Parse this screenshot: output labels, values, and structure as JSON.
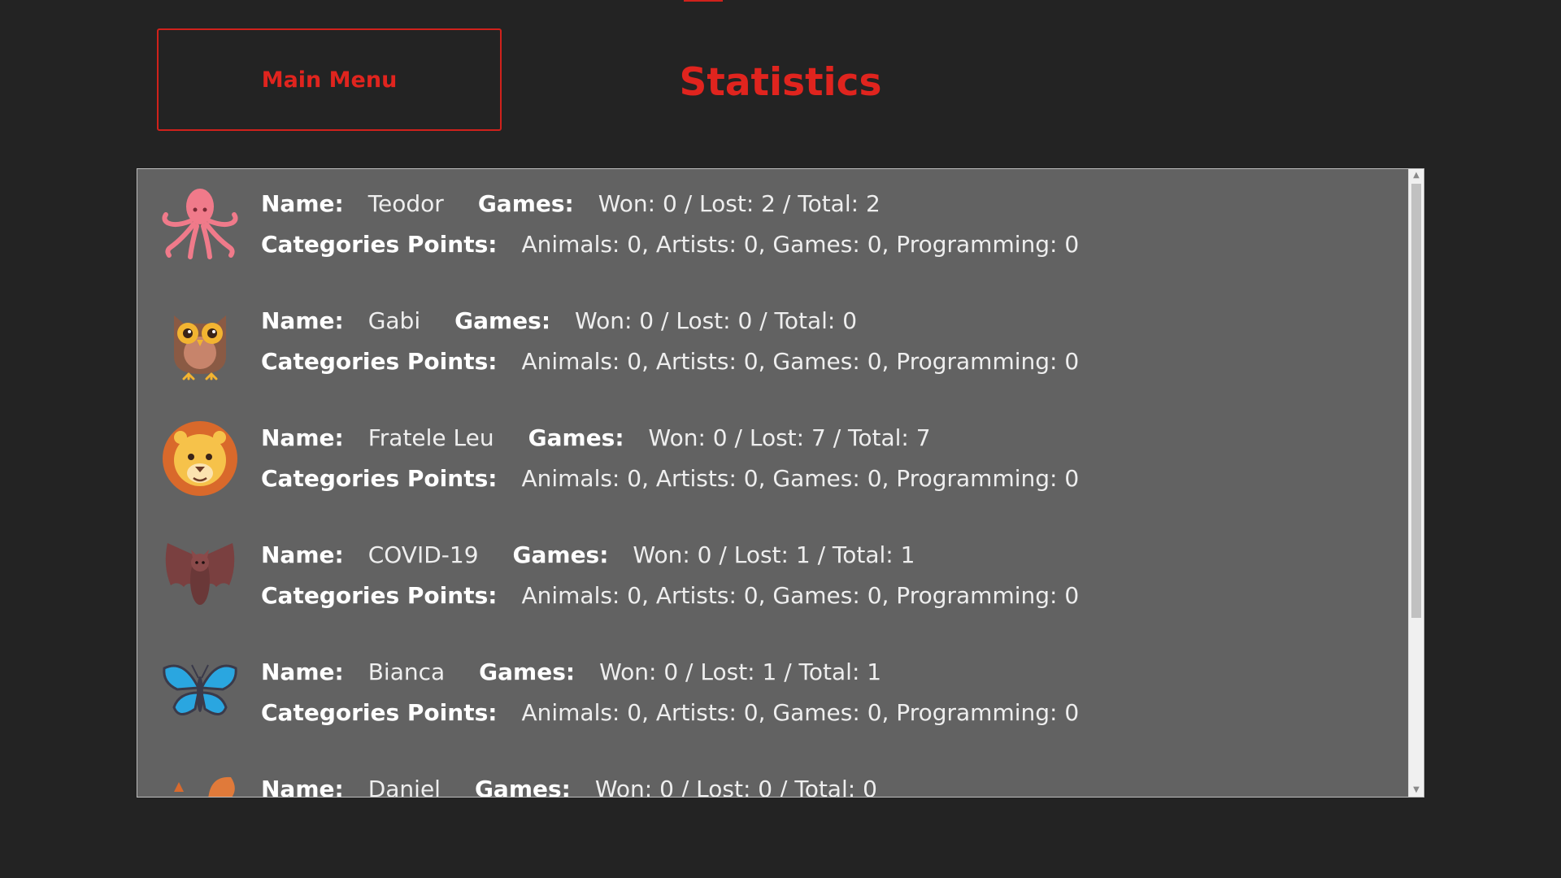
{
  "header": {
    "main_menu_label": "Main Menu",
    "title": "Statistics"
  },
  "labels": {
    "name": "Name:",
    "games": "Games:",
    "categories_points": "Categories Points:"
  },
  "players": [
    {
      "avatar": "octopus-icon",
      "name": "Teodor",
      "games": "Won: 0 / Lost: 2 / Total: 2",
      "categories": "Animals: 0, Artists: 0, Games: 0, Programming: 0"
    },
    {
      "avatar": "owl-icon",
      "name": "Gabi",
      "games": "Won: 0 / Lost: 0 / Total: 0",
      "categories": "Animals: 0, Artists: 0, Games: 0, Programming: 0"
    },
    {
      "avatar": "lion-icon",
      "name": "Fratele Leu",
      "games": "Won: 0 / Lost: 7 / Total: 7",
      "categories": "Animals: 0, Artists: 0, Games: 0, Programming: 0"
    },
    {
      "avatar": "bat-icon",
      "name": "COVID-19",
      "games": "Won: 0 / Lost: 1 / Total: 1",
      "categories": "Animals: 0, Artists: 0, Games: 0, Programming: 0"
    },
    {
      "avatar": "butterfly-icon",
      "name": "Bianca",
      "games": "Won: 0 / Lost: 1 / Total: 1",
      "categories": "Animals: 0, Artists: 0, Games: 0, Programming: 0"
    },
    {
      "avatar": "squirrel-icon",
      "name": "Daniel",
      "games": "Won: 0 / Lost: 0 / Total: 0",
      "categories": ""
    }
  ],
  "colors": {
    "background": "#232323",
    "accent": "#e0241e",
    "panel": "#626262"
  }
}
